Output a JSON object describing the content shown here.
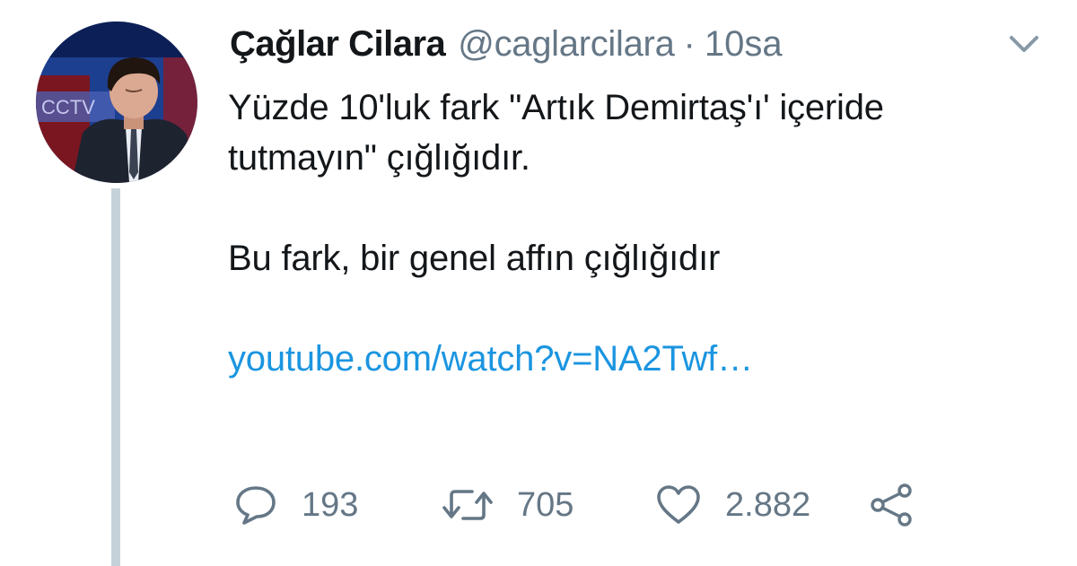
{
  "tweet": {
    "author": {
      "display_name": "Çağlar Cilara",
      "handle": "@caglarcilara"
    },
    "separator": "·",
    "time": "10sa",
    "paragraphs": [
      "Yüzde 10'luk fark \"Artık Demirtaş'ı' içeride tutmayın\" çığlığıdır.",
      "Bu fark, bir genel affın çığlığıdır"
    ],
    "link_text": "youtube.com/watch?v=NA2Twf…",
    "actions": {
      "replies": "193",
      "retweets": "705",
      "likes": "2.882"
    }
  },
  "icons": {
    "caret": "chevron-down-icon",
    "reply": "reply-icon",
    "retweet": "retweet-icon",
    "like": "heart-icon",
    "share": "share-icon"
  },
  "colors": {
    "link": "#1b95e0",
    "secondary_text": "#657786",
    "thread_line": "#c6d2da"
  }
}
